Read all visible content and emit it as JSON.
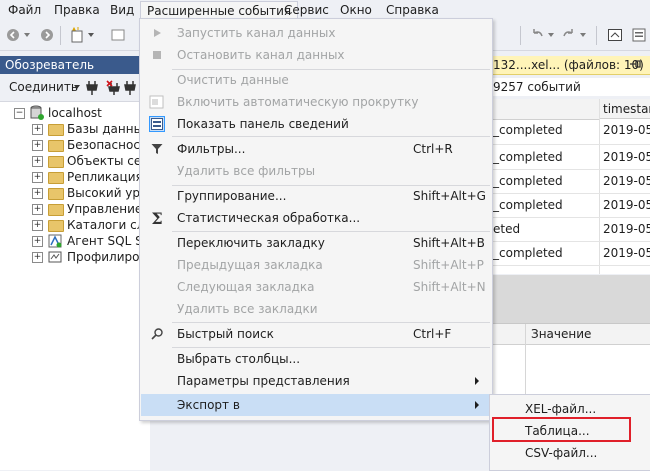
{
  "menubar": {
    "items": [
      "Файл",
      "Правка",
      "Вид",
      "Расширенные события",
      "Сервис",
      "Окно",
      "Справка"
    ]
  },
  "object_explorer": {
    "title": "Обозреватель объектов",
    "connect_label": "Соединить",
    "root": "localhost",
    "nodes": [
      "Базы данных",
      "Безопасность",
      "Объекты серв",
      "Репликация",
      "Высокий уров",
      "Управление",
      "Каталоги служ",
      "Агент SQL Ser",
      "Профилировщ"
    ]
  },
  "doc": {
    "tab_label": "132....xel... (файлов: 10)",
    "events_info": "9257 событий"
  },
  "grid": {
    "timestamp_header": "timestamp",
    "rows": [
      {
        "name": "_completed",
        "timestamp": "2019-05-0"
      },
      {
        "name": "_completed",
        "timestamp": "2019-05-0"
      },
      {
        "name": "_completed",
        "timestamp": "2019-05-0"
      },
      {
        "name": "_completed",
        "timestamp": "2019-05-0"
      },
      {
        "name": "eted",
        "timestamp": "2019-05-0"
      },
      {
        "name": "_completed",
        "timestamp": "2019-05-0"
      }
    ]
  },
  "details": {
    "value_header": "Значение"
  },
  "dropdown": {
    "items": {
      "start_feed": "Запустить канал данных",
      "stop_feed": "Остановить канал данных",
      "clear_data": "Очистить данные",
      "autoscroll": "Включить автоматическую прокрутку",
      "show_details": "Показать панель сведений",
      "filters": "Фильтры...",
      "filters_shortcut": "Ctrl+R",
      "remove_filters": "Удалить все фильтры",
      "grouping": "Группирование...",
      "grouping_shortcut": "Shift+Alt+G",
      "aggregation": "Статистическая обработка...",
      "toggle_bookmark": "Переключить закладку",
      "toggle_bookmark_shortcut": "Shift+Alt+B",
      "prev_bookmark": "Предыдущая закладка",
      "prev_bookmark_shortcut": "Shift+Alt+P",
      "next_bookmark": "Следующая закладка",
      "next_bookmark_shortcut": "Shift+Alt+N",
      "remove_bookmarks": "Удалить все закладки",
      "quick_find": "Быстрый поиск",
      "quick_find_shortcut": "Ctrl+F",
      "choose_columns": "Выбрать столбцы...",
      "view_settings": "Параметры представления",
      "export_to": "Экспорт в"
    }
  },
  "submenu": {
    "xel": "XEL-файл...",
    "table": "Таблица...",
    "csv": "CSV-файл..."
  },
  "colors": {
    "accent_blue": "#3a5a8c",
    "menu_highlight": "#c9def5",
    "callout_red": "#e0202a",
    "doc_tab_yellow": "#fff4b8"
  }
}
